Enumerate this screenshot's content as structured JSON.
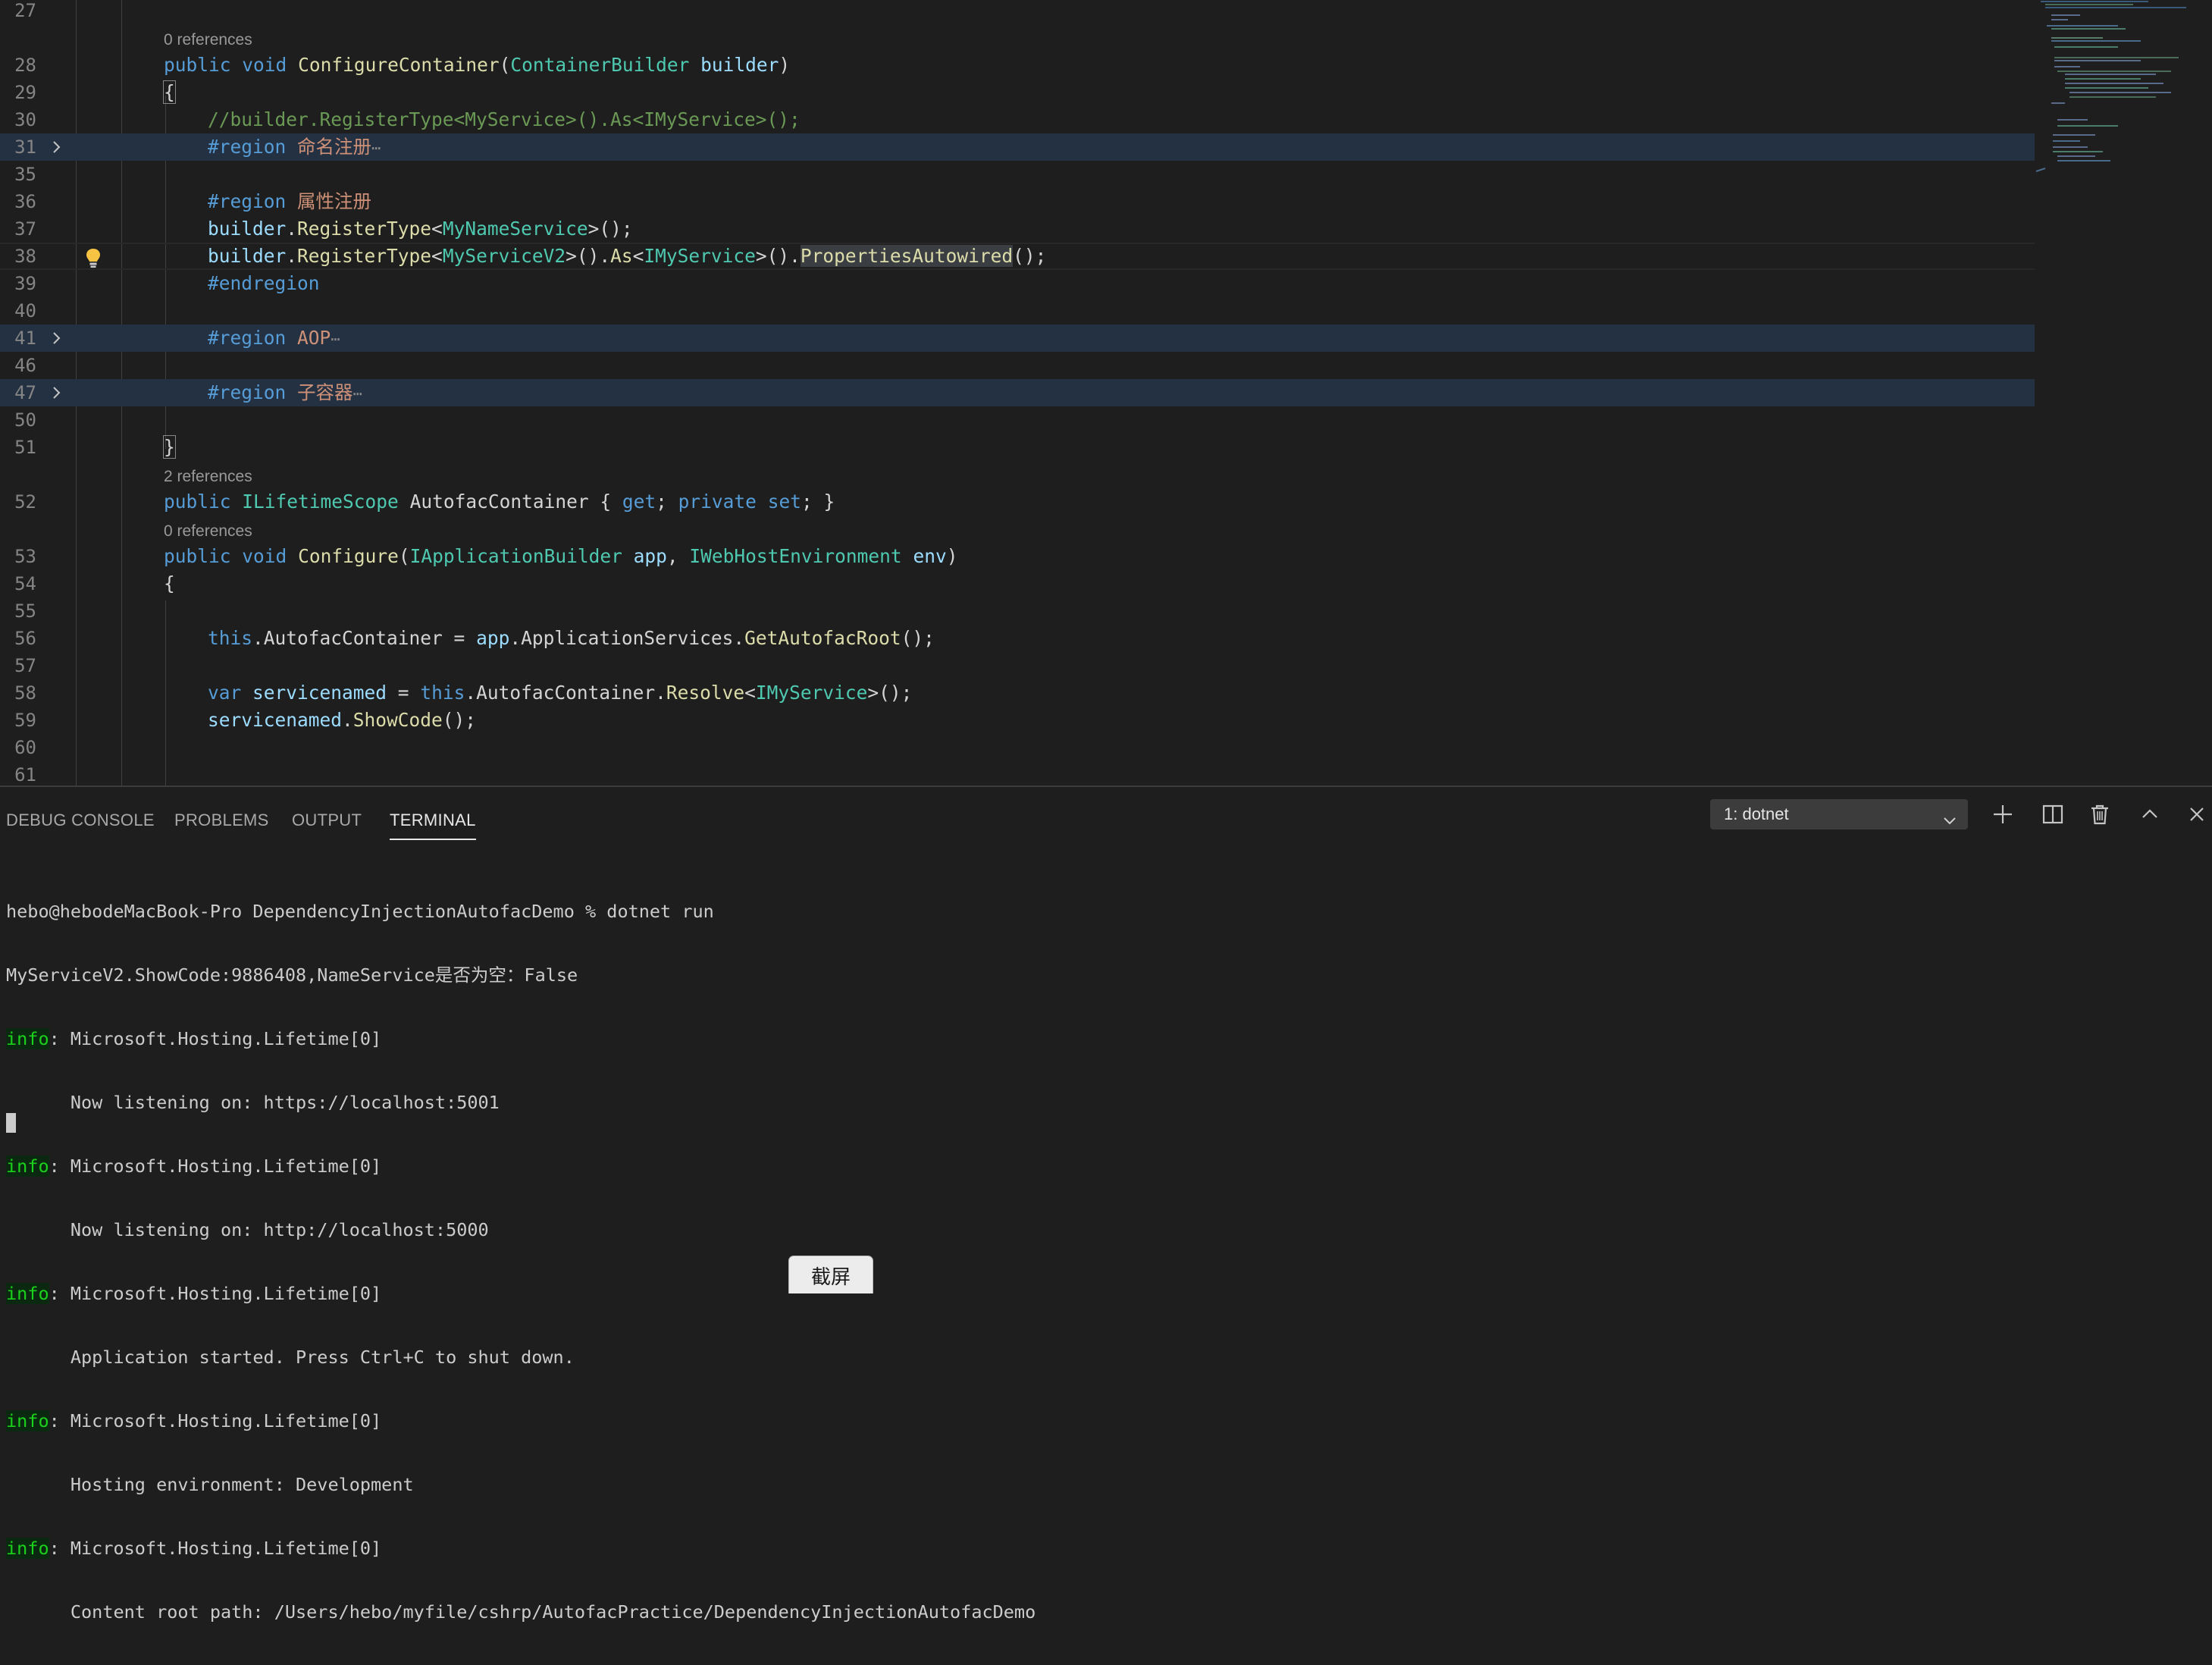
{
  "editor": {
    "lines": {
      "l27": "27",
      "l28": "28",
      "l29": "29",
      "l30": "30",
      "l31": "31",
      "l35": "35",
      "l36": "36",
      "l37": "37",
      "l38": "38",
      "l39": "39",
      "l40": "40",
      "l41": "41",
      "l46": "46",
      "l47": "47",
      "l50": "50",
      "l51": "51",
      "l52": "52",
      "l53": "53",
      "l54": "54",
      "l55": "55",
      "l56": "56",
      "l57": "57",
      "l58": "58",
      "l59": "59",
      "l60": "60",
      "l61": "61"
    },
    "codelens": {
      "configure_container": "0 references",
      "autofac_container": "2 references",
      "configure": "0 references"
    },
    "code": {
      "l28_public": "public",
      "l28_void": "void",
      "l28_method": "ConfigureContainer",
      "l28_open": "(",
      "l28_type": "ContainerBuilder",
      "l28_param": "builder",
      "l28_close": ")",
      "l29_brace": "{",
      "l30_comment": "//builder.RegisterType<MyService>().As<IMyService>();",
      "l31_region": "#region",
      "l31_name": "命名注册",
      "fold_dots": "⋯",
      "l36_region": "#region",
      "l36_name": "属性注册",
      "l37_builder": "builder",
      "l37_method": "RegisterType",
      "l37_type": "MyNameService",
      "l37_tail": ">();",
      "l38_builder": "builder",
      "l38_method": "RegisterType",
      "l38_type": "MyServiceV2",
      "l38_as": "As",
      "l38_iface": "IMyService",
      "l38_props": "PropertiesAutowired",
      "l38_tail": "();",
      "l39_endregion": "#endregion",
      "l41_region": "#region",
      "l41_name": "AOP",
      "l47_region": "#region",
      "l47_name": "子容器",
      "l51_brace": "}",
      "l52_public": "public",
      "l52_type": "ILifetimeScope",
      "l52_prop": "AutofacContainer",
      "l52_ob": "{",
      "l52_get": "get",
      "l52_private": "private",
      "l52_set": "set",
      "l52_cb": "}",
      "l53_public": "public",
      "l53_void": "void",
      "l53_method": "Configure",
      "l53_type1": "IApplicationBuilder",
      "l53_p1": "app",
      "l53_type2": "IWebHostEnvironment",
      "l53_p2": "env",
      "l54_brace": "{",
      "l56_this": "this",
      "l56_prop": "AutofacContainer",
      "l56_app": "app",
      "l56_svc": "ApplicationServices",
      "l56_method": "GetAutofacRoot",
      "l56_tail": "();",
      "l58_var": "var",
      "l58_name": "servicenamed",
      "l58_this": "this",
      "l58_prop": "AutofacContainer",
      "l58_method": "Resolve",
      "l58_type": "IMyService",
      "l58_tail": ">();",
      "l59_name": "servicenamed",
      "l59_method": "ShowCode",
      "l59_tail": "();"
    }
  },
  "panel": {
    "tabs": {
      "debug_console": "DEBUG CONSOLE",
      "problems": "PROBLEMS",
      "output": "OUTPUT",
      "terminal": "TERMINAL"
    },
    "terminal_selector": "1: dotnet",
    "terminal_lines": {
      "prompt": "hebo@hebodeMacBook-Pro DependencyInjectionAutofacDemo % dotnet run",
      "showcode": "MyServiceV2.ShowCode:9886408,NameService是否为空：False",
      "info_tag": "info",
      "lifetime": ": Microsoft.Hosting.Lifetime[0]",
      "listen_https": "      Now listening on: https://localhost:5001",
      "listen_http": "      Now listening on: http://localhost:5000",
      "started": "      Application started. Press Ctrl+C to shut down.",
      "environment": "      Hosting environment: Development",
      "content_root": "      Content root path: /Users/hebo/myfile/cshrp/AutofacPractice/DependencyInjectionAutofacDemo"
    }
  },
  "overlay": {
    "screenshot_button": "截屏"
  },
  "icons": {
    "fold_chevron": "chevron-right-icon",
    "lightbulb": "lightbulb-icon",
    "new_terminal": "plus-icon",
    "split_terminal": "split-icon",
    "kill_terminal": "trash-icon",
    "maximize_panel": "chevron-up-icon",
    "close_panel": "close-icon"
  },
  "colors": {
    "background": "#1e1e1e",
    "keyword": "#569cd6",
    "type": "#4ec9b0",
    "function": "#dcdcaa",
    "parameter": "#9cdcfe",
    "comment": "#6a9955",
    "region_name": "#ce9178",
    "info_green": "#1bd11b"
  }
}
